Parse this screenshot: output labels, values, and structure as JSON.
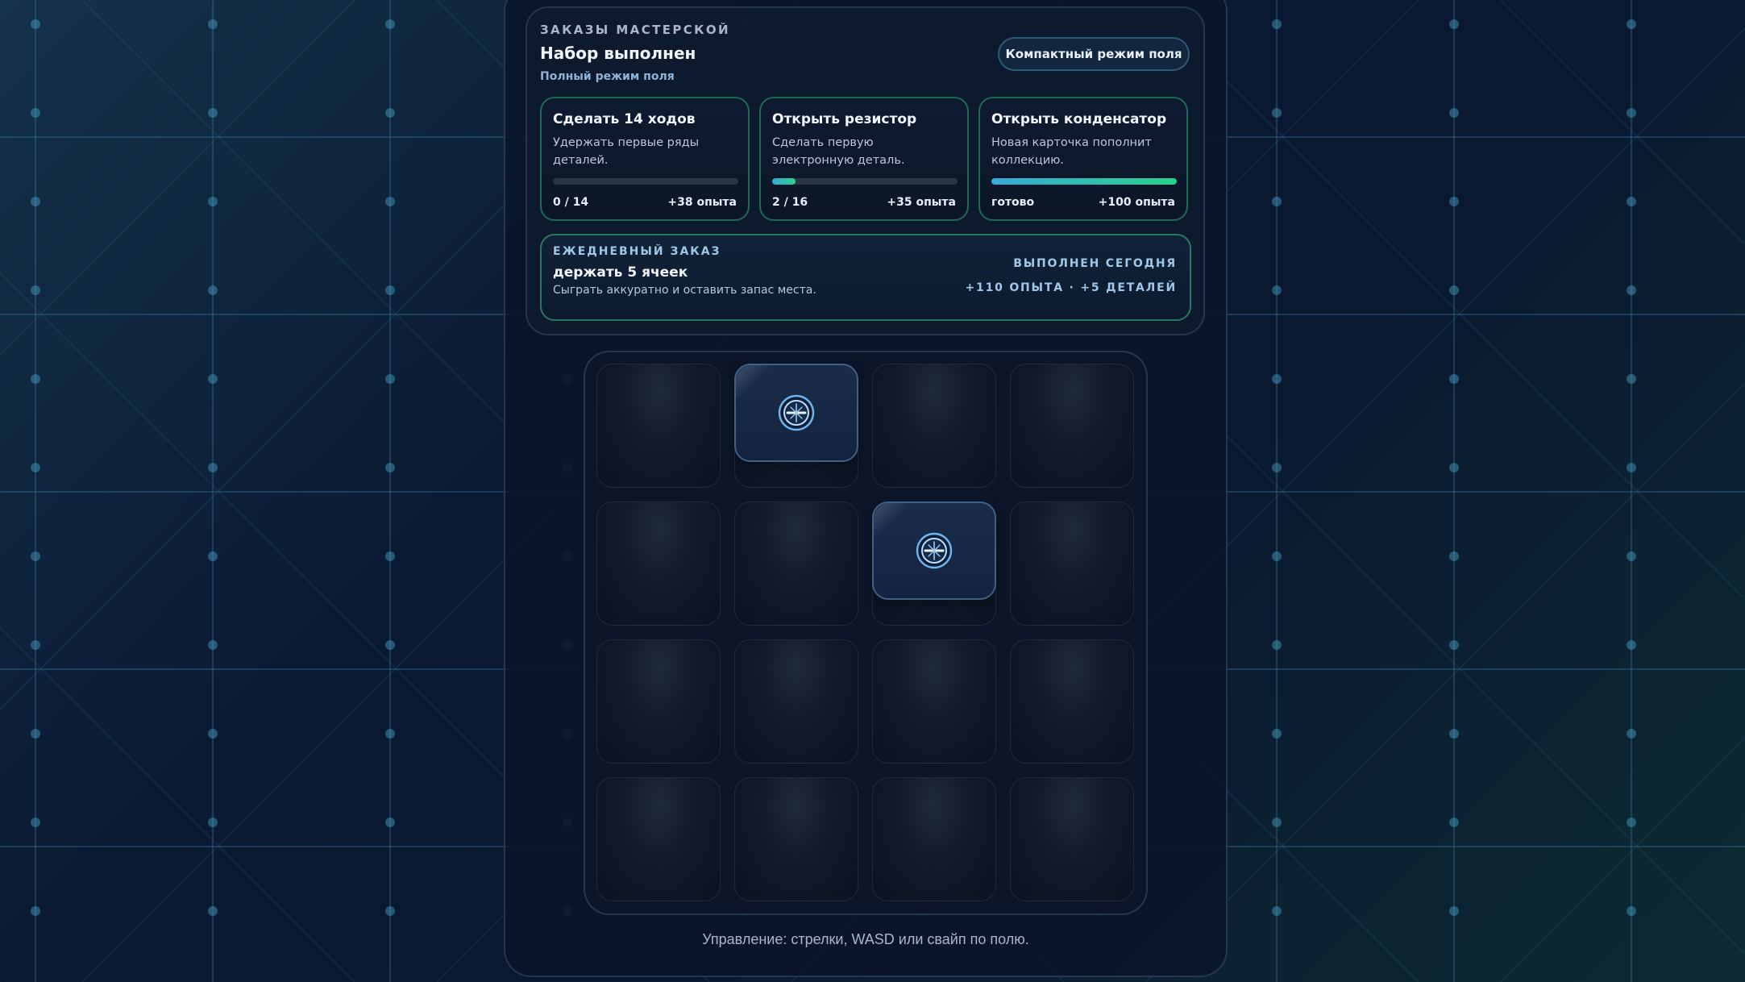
{
  "orders": {
    "eyebrow": "ЗАКАЗЫ МАСТЕРСКОЙ",
    "title": "Набор выполнен",
    "mode_caption": "Полный режим поля",
    "compact_button_label": "Компактный режим поля",
    "cards": [
      {
        "title": "Сделать 14 ходов",
        "description": "Удержать первые ряды деталей.",
        "progress": 0,
        "progress_text": "0 / 14",
        "reward": "+38 опыта"
      },
      {
        "title": "Открыть резистор",
        "description": "Сделать первую электронную деталь.",
        "progress": 0.125,
        "progress_text": "2 / 16",
        "reward": "+35 опыта"
      },
      {
        "title": "Открыть конденсатор",
        "description": "Новая карточка пополнит коллекцию.",
        "progress": 1,
        "progress_text": "готово",
        "reward": "+100 опыта"
      }
    ],
    "daily": {
      "eyebrow": "ЕЖЕДНЕВНЫЙ ЗАКАЗ",
      "title": "держать 5 ячеек",
      "description": "Сыграть аккуратно и оставить запас места.",
      "status": "ВЫПОЛНЕН СЕГОДНЯ",
      "reward": "+110 ОПЫТА · +5 ДЕТАЛЕЙ"
    }
  },
  "board": {
    "rows": 4,
    "cols": 4,
    "tiles": [
      {
        "row": 0,
        "col": 1,
        "icon": "screw-part-icon"
      },
      {
        "row": 1,
        "col": 2,
        "icon": "screw-part-icon"
      }
    ]
  },
  "footer_hint": "Управление: стрелки, WASD или свайп по полю.",
  "colors": {
    "accent_green": "#2bd08a",
    "accent_blue": "#38a9d8",
    "card_border": "#1f6a55",
    "tile_border": "#3f6088"
  }
}
